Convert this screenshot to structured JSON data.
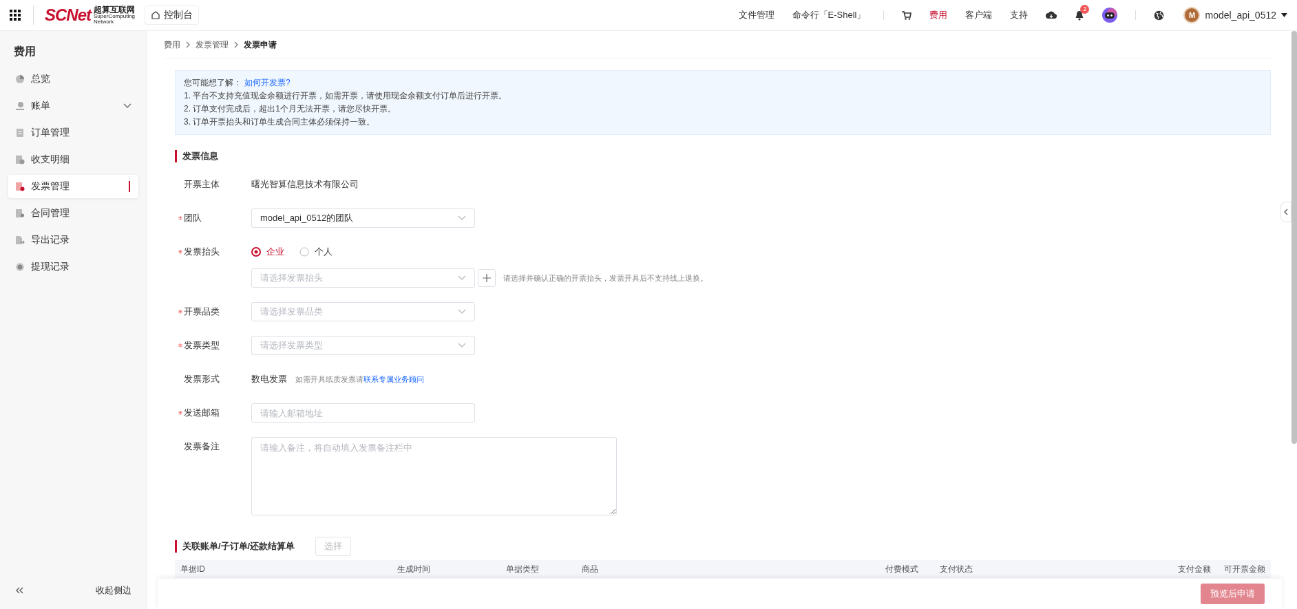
{
  "topbar": {
    "logo": {
      "mark": "SCNet",
      "name": "超算互联网",
      "tagline_1": "SuperComputing",
      "tagline_2": "Network"
    },
    "home_button": "控制台",
    "nav": [
      {
        "kind": "link",
        "label": "文件管理",
        "selected": false
      },
      {
        "kind": "link",
        "label": "命令行「E-Shell」",
        "selected": false
      },
      {
        "kind": "cart"
      },
      {
        "kind": "link",
        "label": "费用",
        "selected": true
      },
      {
        "kind": "link",
        "label": "客户端",
        "selected": false
      },
      {
        "kind": "link",
        "label": "支持",
        "selected": false
      },
      {
        "kind": "cloud"
      },
      {
        "kind": "bell",
        "badge": "2"
      },
      {
        "kind": "robot"
      },
      {
        "kind": "globe"
      }
    ],
    "user": {
      "initial": "M",
      "name": "model_api_0512"
    }
  },
  "sidebar": {
    "title": "费用",
    "items": [
      {
        "label": "总览",
        "selected": false
      },
      {
        "label": "账单",
        "selected": false,
        "expanded": false
      },
      {
        "label": "订单管理",
        "selected": false
      },
      {
        "label": "收支明细",
        "selected": false
      },
      {
        "label": "发票管理",
        "selected": true
      },
      {
        "label": "合同管理",
        "selected": false
      },
      {
        "label": "导出记录",
        "selected": false
      },
      {
        "label": "提现记录",
        "selected": false
      }
    ],
    "collapse": "收起侧边"
  },
  "breadcrumb": [
    "费用",
    "发票管理",
    "发票申请"
  ],
  "notice": {
    "lead": "您可能想了解：",
    "link": "如何开发票?",
    "lines": [
      "1. 平台不支持充值现金余额进行开票，如需开票，请使用现金余额支付订单后进行开票。",
      "2. 订单支付完成后，超出1个月无法开票，请您尽快开票。",
      "3. 订单开票抬头和订单生成合同主体必须保持一致。"
    ]
  },
  "form": {
    "title": "发票信息",
    "fields": [
      {
        "kind": "text",
        "label": "开票主体",
        "required": false,
        "value": "曙光智算信息技术有限公司"
      },
      {
        "kind": "select",
        "label": "团队",
        "required": true,
        "value": "model_api_0512的团队"
      },
      {
        "kind": "radio-select",
        "label": "发票抬头",
        "required": true,
        "options": [
          {
            "label": "企业",
            "selected": true
          },
          {
            "label": "个人",
            "selected": false
          }
        ],
        "placeholder": "请选择发票抬头",
        "hint": "请选择并确认正确的开票抬头，发票开具后不支持线上退换。"
      },
      {
        "kind": "select",
        "label": "开票品类",
        "required": true,
        "placeholder": "请选择发票品类"
      },
      {
        "kind": "select",
        "label": "发票类型",
        "required": true,
        "placeholder": "请选择发票类型"
      },
      {
        "kind": "note",
        "label": "发票形式",
        "required": false,
        "value": "数电发票",
        "hint": "如需开具纸质发票请",
        "link": "联系专属业务顾问"
      },
      {
        "kind": "input",
        "label": "发送邮箱",
        "required": true,
        "placeholder": "请输入邮箱地址"
      },
      {
        "kind": "textarea",
        "label": "发票备注",
        "required": false,
        "placeholder": "请输入备注，将自动填入发票备注栏中"
      }
    ]
  },
  "orders": {
    "title": "关联账单/子订单/还款结算单",
    "button": {
      "label": "选择",
      "disabled": true
    },
    "columns": [
      "单据ID",
      "生成时间",
      "单据类型",
      "商品",
      "付费模式",
      "支付状态",
      "支付金额",
      "可开票金额"
    ]
  },
  "footer": {
    "button": {
      "label": "预览后申请",
      "disabled": true
    }
  }
}
